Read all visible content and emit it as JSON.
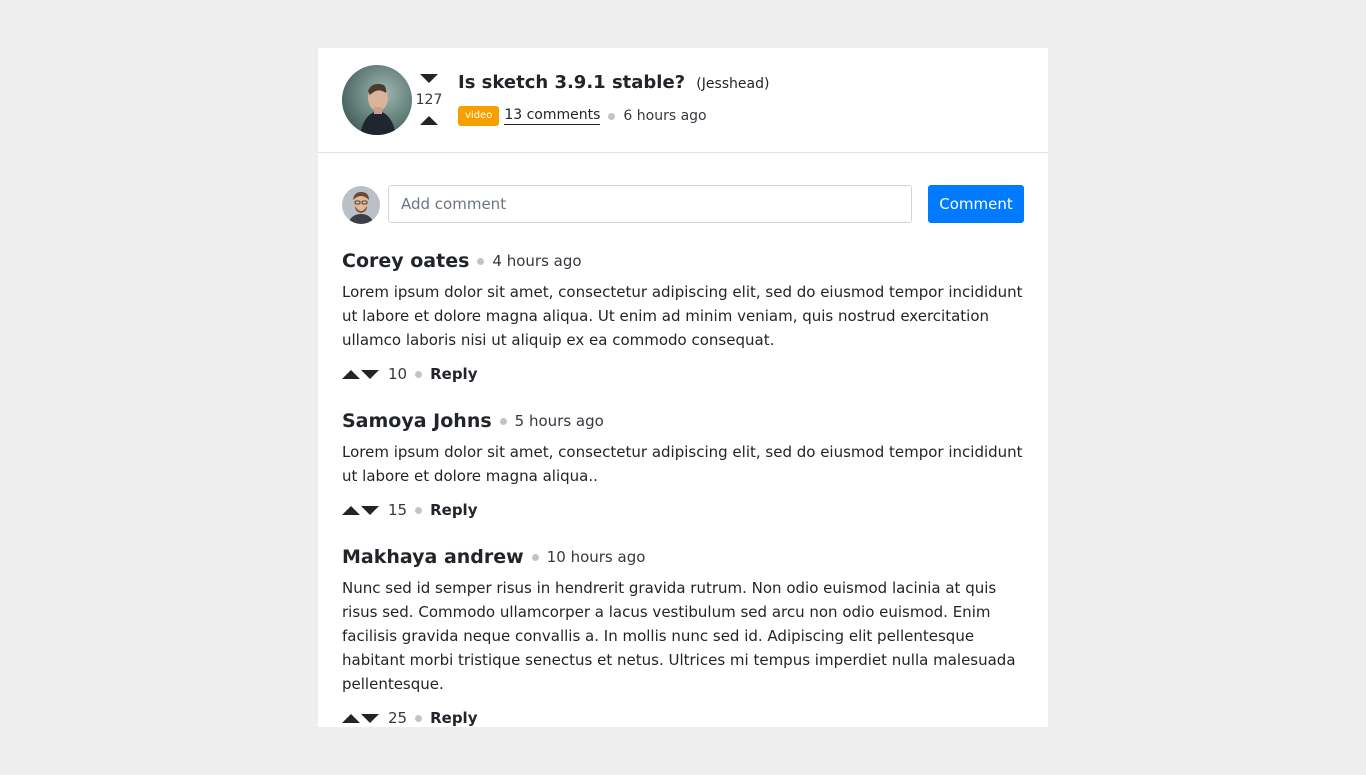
{
  "post": {
    "title": "Is sketch 3.9.1 stable?",
    "author": "(Jesshead)",
    "votes": "127",
    "badge": "video",
    "comments_link": "13 comments",
    "time": "6 hours ago"
  },
  "composer": {
    "placeholder": "Add comment",
    "button_label": "Comment"
  },
  "comments": [
    {
      "author": "Corey oates",
      "time": "4 hours ago",
      "body": "Lorem ipsum dolor sit amet, consectetur adipiscing elit, sed do eiusmod tempor incididunt ut labore et dolore magna aliqua. Ut enim ad minim veniam, quis nostrud exercitation ullamco laboris nisi ut aliquip ex ea commodo consequat.",
      "votes": "10",
      "reply": "Reply"
    },
    {
      "author": "Samoya Johns",
      "time": "5 hours ago",
      "body": "Lorem ipsum dolor sit amet, consectetur adipiscing elit, sed do eiusmod tempor incididunt ut labore et dolore magna aliqua..",
      "votes": "15",
      "reply": "Reply"
    },
    {
      "author": "Makhaya andrew",
      "time": "10 hours ago",
      "body": "Nunc sed id semper risus in hendrerit gravida rutrum. Non odio euismod lacinia at quis risus sed. Commodo ullamcorper a lacus vestibulum sed arcu non odio euismod. Enim facilisis gravida neque convallis a. In mollis nunc sed id. Adipiscing elit pellentesque habitant morbi tristique senectus et netus. Ultrices mi tempus imperdiet nulla malesuada pellentesque.",
      "votes": "25",
      "reply": "Reply"
    }
  ],
  "colors": {
    "page_bg": "#eeeeee",
    "card_bg": "#ffffff",
    "badge": "#f5a000",
    "primary": "#007bff",
    "dot": "#c4c4c4",
    "text": "#212529"
  },
  "icons": {
    "post_avatar": "author-avatar-photo",
    "composer_avatar": "user-avatar-photo",
    "upvote": "triangle-up-icon",
    "downvote": "triangle-down-icon",
    "separator": "dot-icon"
  }
}
